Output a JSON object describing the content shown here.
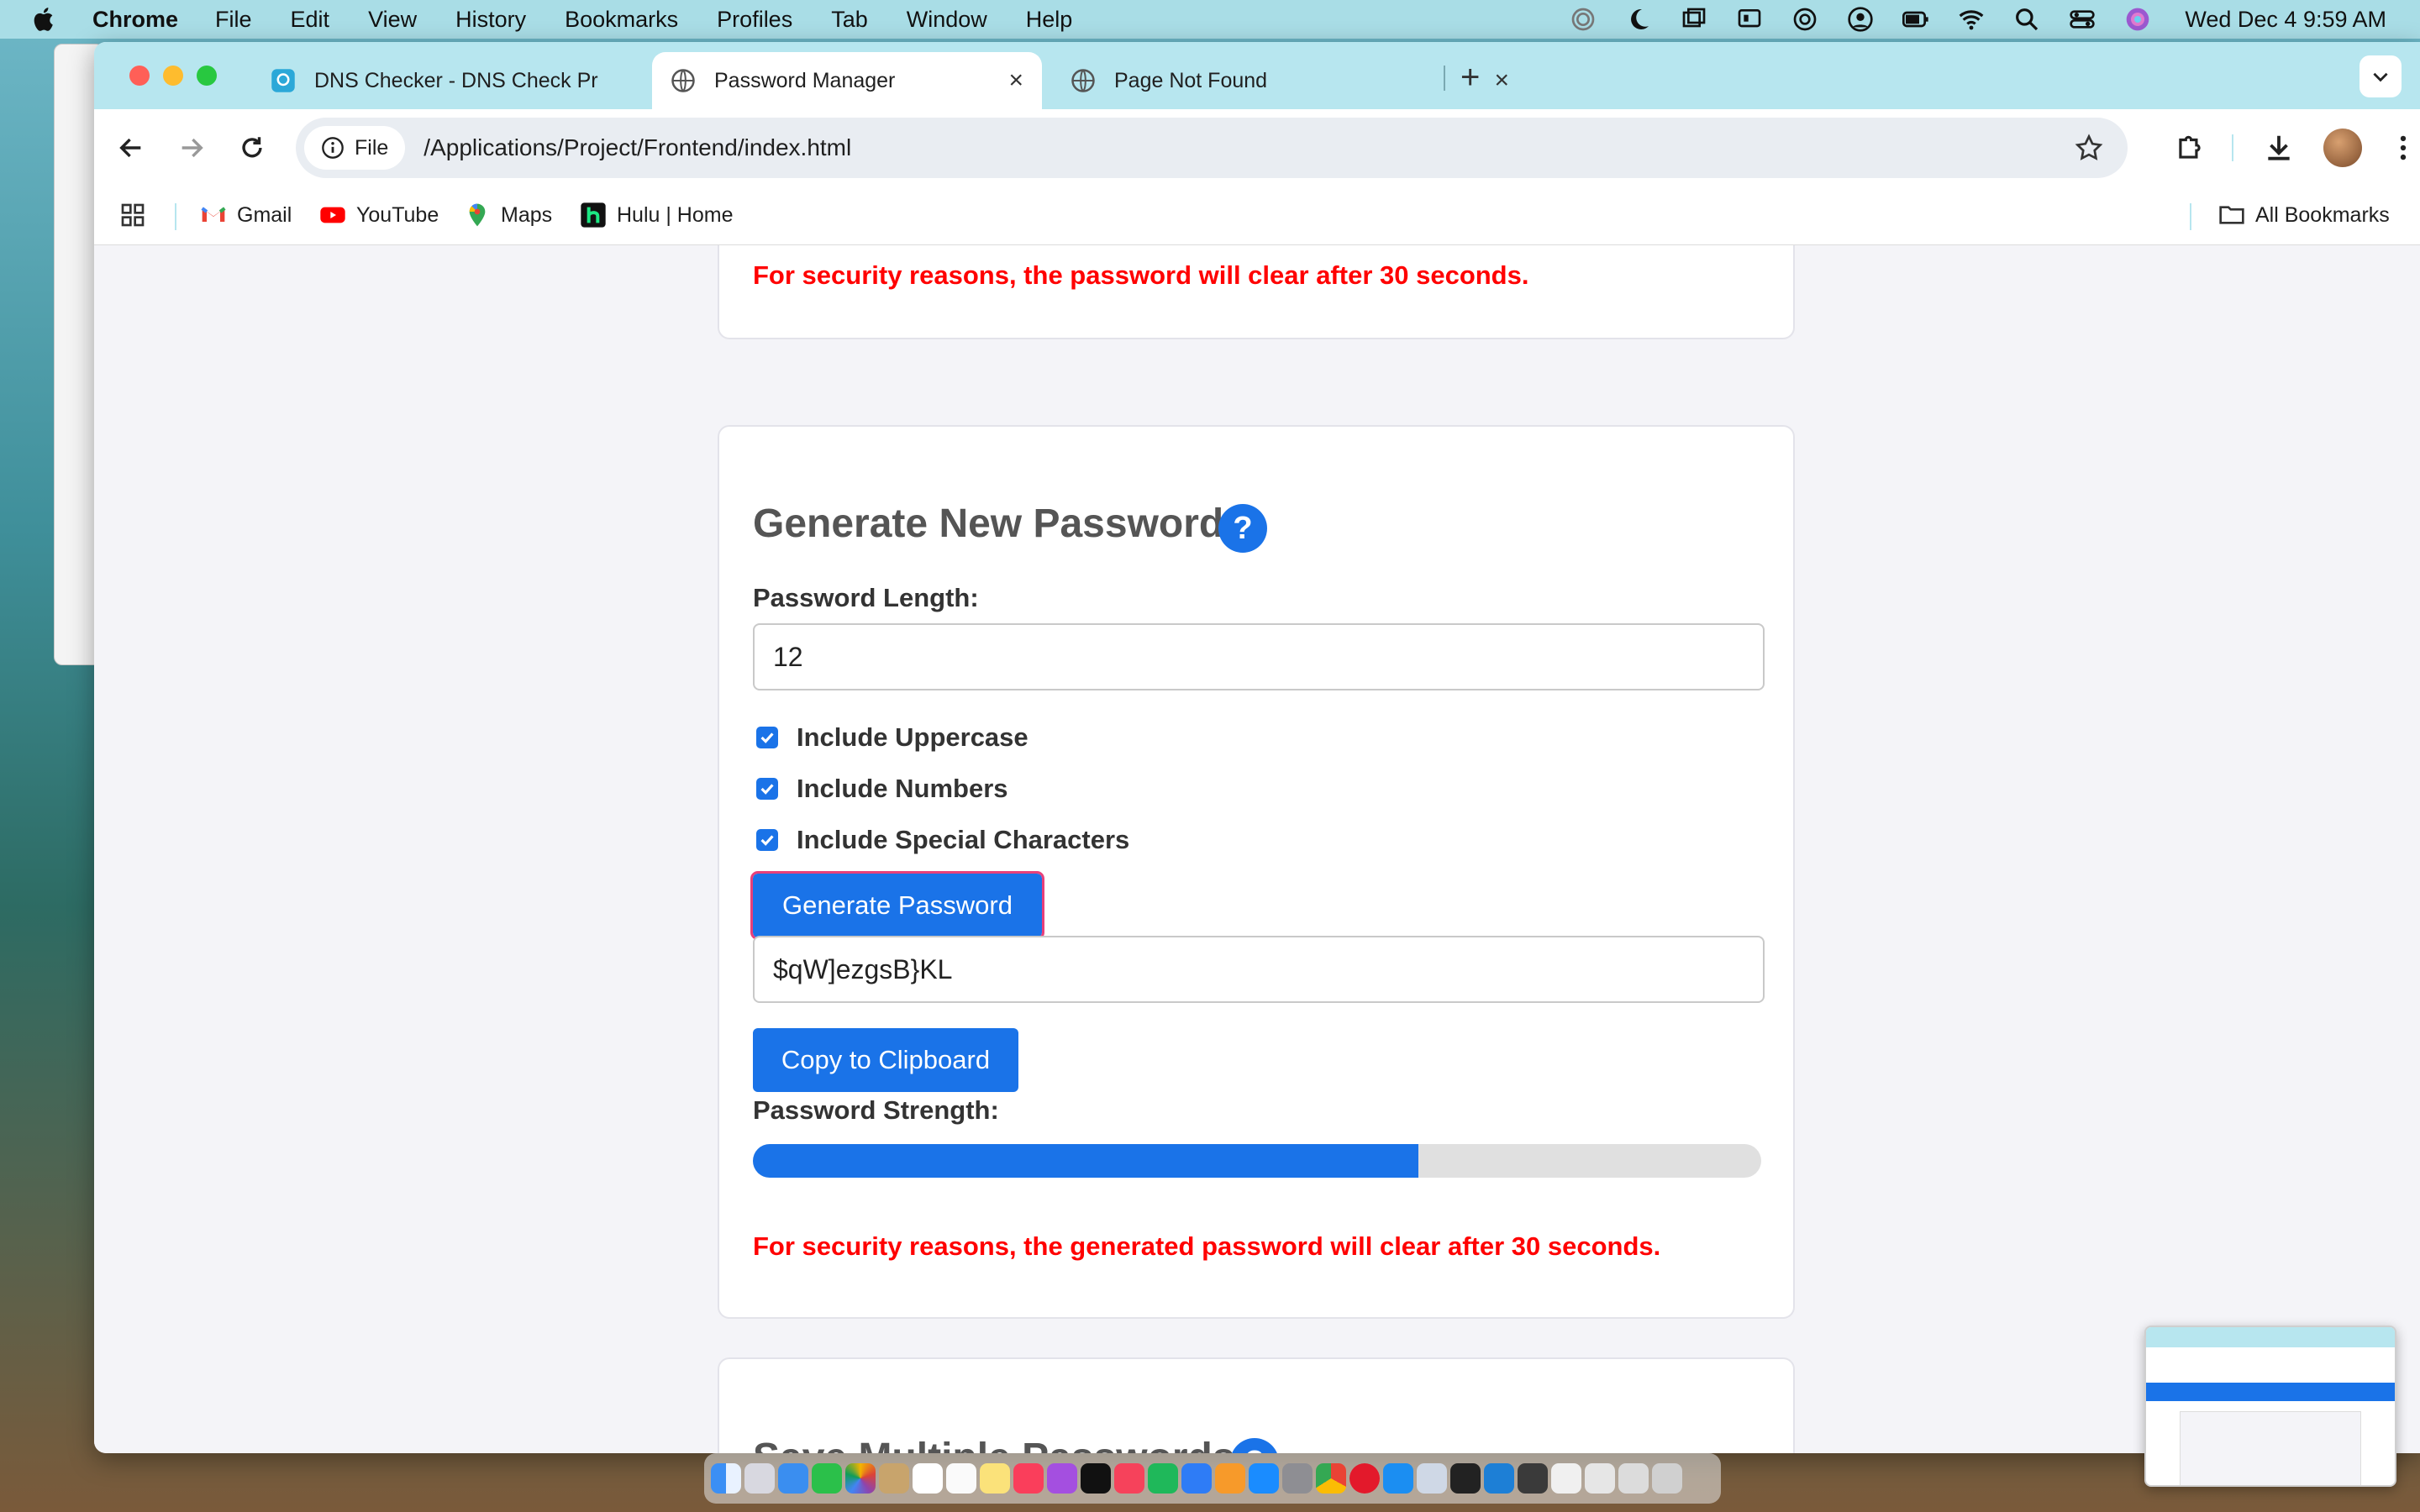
{
  "menubar": {
    "app": "Chrome",
    "items": [
      "File",
      "Edit",
      "View",
      "History",
      "Bookmarks",
      "Profiles",
      "Tab",
      "Window",
      "Help"
    ],
    "clock": "Wed Dec 4  9:59 AM"
  },
  "tabs": [
    {
      "title": "DNS Checker - DNS Check Pr",
      "icon": "dns-checker-favicon"
    },
    {
      "title": "Password Manager",
      "icon": "globe-icon"
    },
    {
      "title": "Page Not Found",
      "icon": "globe-icon"
    }
  ],
  "omnibox": {
    "chip": "File",
    "url": "/Applications/Project/Frontend/index.html"
  },
  "bookmarks": [
    {
      "label": "Gmail",
      "icon": "gmail-icon"
    },
    {
      "label": "YouTube",
      "icon": "youtube-icon"
    },
    {
      "label": "Maps",
      "icon": "maps-icon"
    },
    {
      "label": "Hulu | Home",
      "icon": "hulu-icon"
    }
  ],
  "all_bookmarks": "All Bookmarks",
  "top_card": {
    "warning": "For security reasons, the password will clear after 30 seconds."
  },
  "generator": {
    "title": "Generate New Password",
    "help": "?",
    "length_label": "Password Length:",
    "length_value": "12",
    "options": [
      {
        "label": "Include Uppercase",
        "checked": true
      },
      {
        "label": "Include Numbers",
        "checked": true
      },
      {
        "label": "Include Special Characters",
        "checked": true
      }
    ],
    "generate_button": "Generate Password",
    "generated_value": "$qW]ezgsB}KL",
    "copy_button": "Copy to Clipboard",
    "strength_label": "Password Strength:",
    "strength_fraction": 0.66,
    "warning": "For security reasons, the generated password will clear after 30 seconds."
  },
  "save_card": {
    "title": "Save Multiple Passwords",
    "help": "?"
  },
  "colors": {
    "accent": "#1a73e8",
    "warning": "#ff0000",
    "tabstrip": "#b7e6ef"
  }
}
